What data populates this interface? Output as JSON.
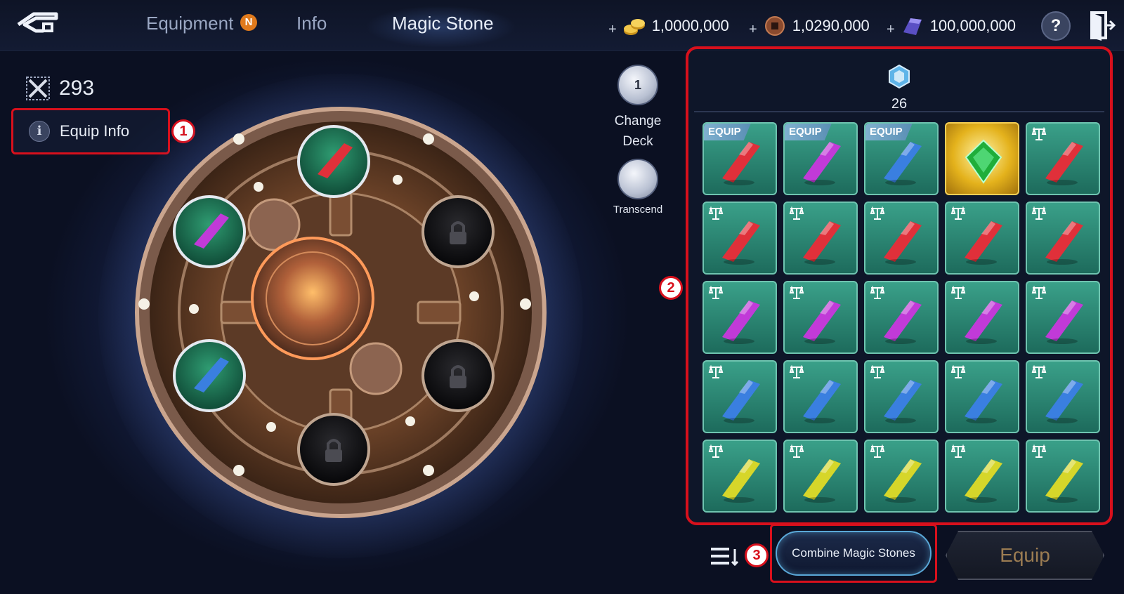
{
  "tabs": [
    {
      "label": "Equipment",
      "badge": "N"
    },
    {
      "label": "Info"
    },
    {
      "label": "Magic Stone",
      "active": true
    }
  ],
  "currencies": [
    {
      "icon": "gold-coins-icon",
      "prefix": "+",
      "amount": "1,0000,000"
    },
    {
      "icon": "copper-coin-icon",
      "prefix": "+",
      "amount": "1,0290,000"
    },
    {
      "icon": "crystal-ingot-icon",
      "prefix": "+",
      "amount": "100,000,000"
    }
  ],
  "help_label": "?",
  "power": {
    "icon": "crossed-swords-icon",
    "value": "293"
  },
  "equip_info": {
    "icon_glyph": "i",
    "label": "Equip Info"
  },
  "callouts": [
    "1",
    "2",
    "3"
  ],
  "tools": {
    "change_deck": {
      "count": "1",
      "label": "Change\nDeck"
    },
    "transcend": {
      "label": "Transcend"
    }
  },
  "stone_count": "26",
  "grid": {
    "equip_tag": "EQUIP",
    "rows": [
      [
        {
          "color": "red",
          "tag": "equip"
        },
        {
          "color": "purple",
          "tag": "equip"
        },
        {
          "color": "blue",
          "tag": "equip"
        },
        {
          "color": "green",
          "tag": "special"
        },
        {
          "color": "red",
          "tag": "scale"
        }
      ],
      [
        {
          "color": "red",
          "tag": "scale"
        },
        {
          "color": "red",
          "tag": "scale"
        },
        {
          "color": "red",
          "tag": "scale"
        },
        {
          "color": "red",
          "tag": "scale"
        },
        {
          "color": "red",
          "tag": "scale"
        }
      ],
      [
        {
          "color": "purple",
          "tag": "scale"
        },
        {
          "color": "purple",
          "tag": "scale"
        },
        {
          "color": "purple",
          "tag": "scale"
        },
        {
          "color": "purple",
          "tag": "scale"
        },
        {
          "color": "purple",
          "tag": "scale"
        }
      ],
      [
        {
          "color": "blue",
          "tag": "scale"
        },
        {
          "color": "blue",
          "tag": "scale"
        },
        {
          "color": "blue",
          "tag": "scale"
        },
        {
          "color": "blue",
          "tag": "scale"
        },
        {
          "color": "blue",
          "tag": "scale"
        }
      ],
      [
        {
          "color": "yellow",
          "tag": "scale"
        },
        {
          "color": "yellow",
          "tag": "scale"
        },
        {
          "color": "yellow",
          "tag": "scale"
        },
        {
          "color": "yellow",
          "tag": "scale"
        },
        {
          "color": "yellow",
          "tag": "scale"
        }
      ]
    ]
  },
  "wheel_slots": [
    {
      "name": "top",
      "state": "gem",
      "color": "red"
    },
    {
      "name": "upper-left",
      "state": "gem",
      "color": "purple"
    },
    {
      "name": "lower-left",
      "state": "gem",
      "color": "blue"
    },
    {
      "name": "upper-right",
      "state": "locked"
    },
    {
      "name": "lower-right",
      "state": "locked"
    },
    {
      "name": "bottom",
      "state": "locked"
    }
  ],
  "buttons": {
    "combine": "Combine Magic Stones",
    "equip": "Equip"
  },
  "colors": {
    "highlight_red": "#d8101c",
    "cell_green": "#2b8a76",
    "gem_red": "#e0303a",
    "gem_purple": "#c13ad8",
    "gem_blue": "#3a7fe0",
    "gem_yellow": "#d6d62a",
    "gem_green": "#1fae3a"
  }
}
